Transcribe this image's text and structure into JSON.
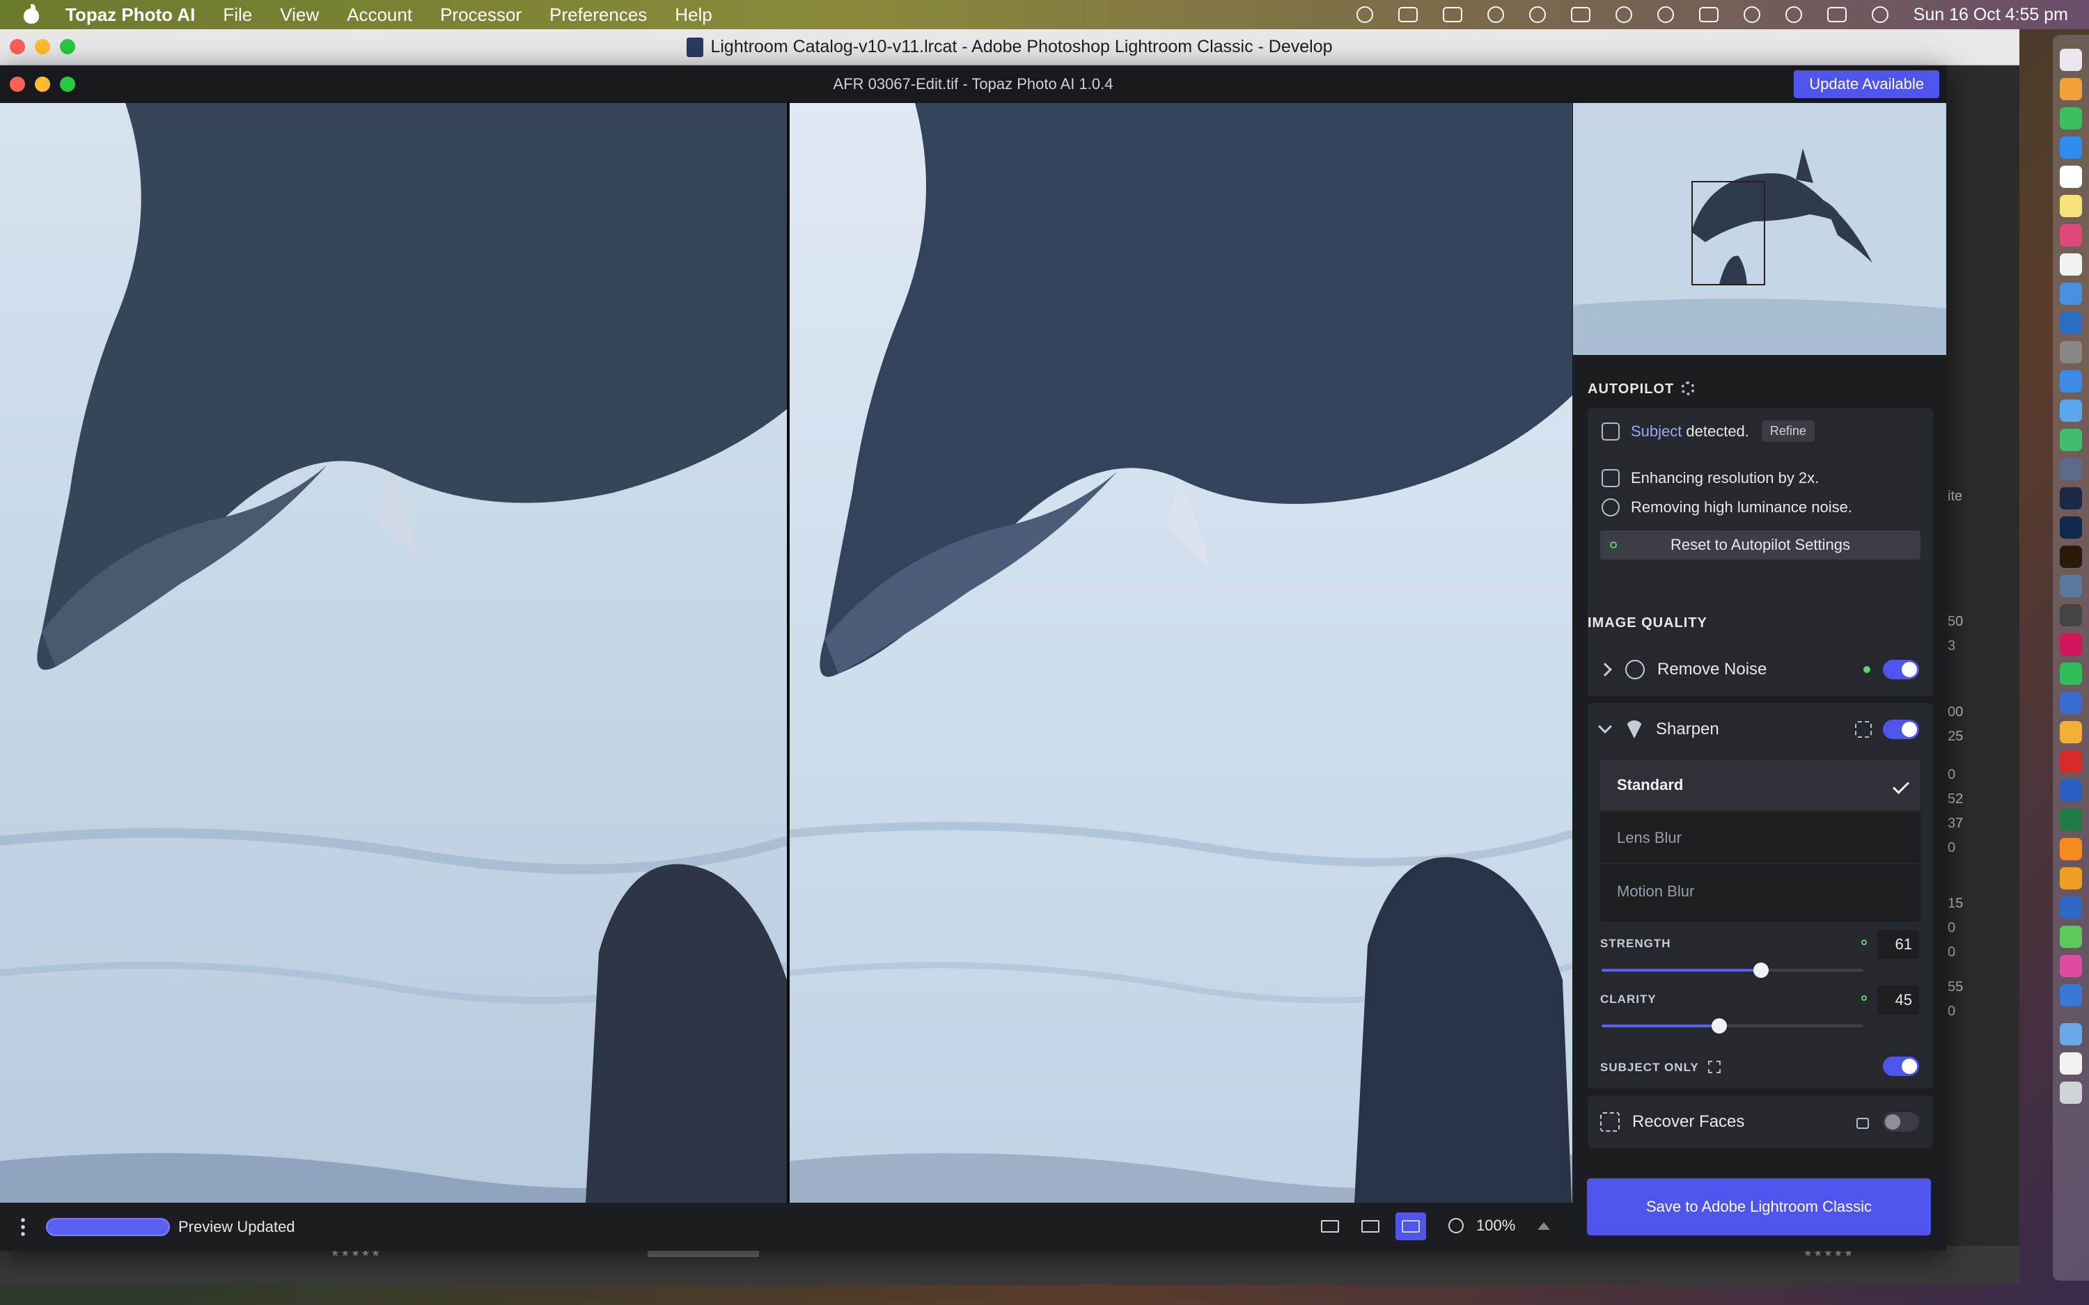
{
  "menubar": {
    "app_name": "Topaz Photo AI",
    "items": [
      "File",
      "View",
      "Account",
      "Processor",
      "Preferences",
      "Help"
    ],
    "clock": "Sun 16 Oct  4:55 pm"
  },
  "lightroom": {
    "window_title": "Lightroom Catalog-v10-v11.lrcat - Adobe Photoshop Lightroom Classic - Develop",
    "side_values": [
      "ite",
      "50",
      "3",
      "00",
      "25",
      "0",
      "52",
      "37",
      "0",
      "15",
      "0",
      "0",
      "55",
      "0"
    ],
    "filmstrip_stars": "★★★★★"
  },
  "topaz": {
    "window_title": "AFR 03067-Edit.tif - Topaz Photo AI 1.0.4",
    "update_label": "Update Available",
    "autopilot": {
      "heading": "AUTOPILOT",
      "subject_word": "Subject",
      "subject_rest": "detected.",
      "refine_label": "Refine",
      "enhance_text": "Enhancing resolution by 2x.",
      "noise_text": "Removing high luminance noise.",
      "reset_label": "Reset to Autopilot Settings"
    },
    "image_quality": {
      "heading": "IMAGE QUALITY",
      "remove_noise_label": "Remove Noise",
      "remove_noise_on": true,
      "sharpen_label": "Sharpen",
      "sharpen_on": true,
      "models": [
        "Standard",
        "Lens Blur",
        "Motion Blur"
      ],
      "selected_model": "Standard",
      "strength_label": "STRENGTH",
      "strength_value": "61",
      "clarity_label": "CLARITY",
      "clarity_value": "45",
      "subject_only_label": "SUBJECT ONLY",
      "subject_only_on": true,
      "recover_faces_label": "Recover Faces",
      "recover_faces_on": false
    },
    "save_label": "Save to Adobe Lightroom Classic",
    "status_text": "Preview Updated",
    "zoom_label": "100%"
  },
  "colors": {
    "accent": "#4f55ec",
    "panel": "#1b1d21",
    "card": "#25282d",
    "status_green": "#5fcf6a"
  },
  "icons": [
    "apple-icon",
    "gear-icon",
    "subject-focus-icon",
    "resize-icon",
    "noise-icon",
    "chevron-icon",
    "sharpen-icon",
    "checkmark-icon",
    "lock-icon",
    "face-icon",
    "kebab-icon",
    "magnifier-icon"
  ]
}
